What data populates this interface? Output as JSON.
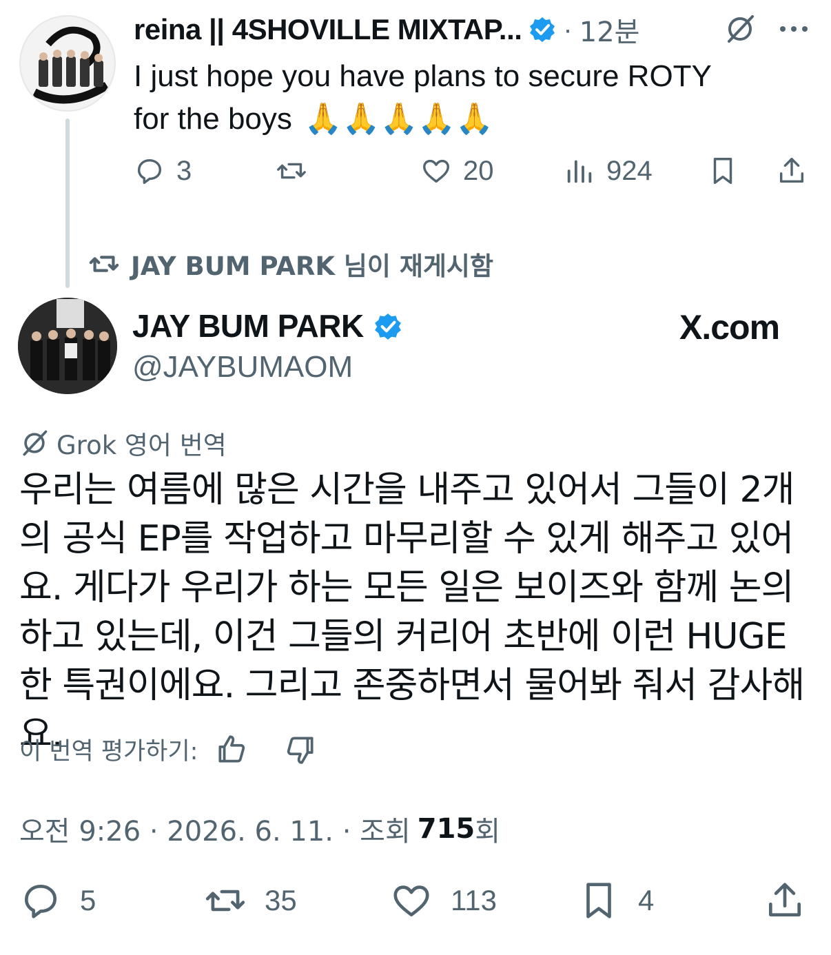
{
  "reply_tweet": {
    "author_name": "reina || 4SHOVILLE MIXTAP...",
    "time": "12분",
    "text_line1": "I just hope you have plans to secure ROTY",
    "text_line2": "for the boys",
    "emoji": "🙏🙏🙏🙏🙏",
    "reply_count": "3",
    "like_count": "20",
    "view_count": "924"
  },
  "repost_label": "JAY BUM PARK 님이 재게시함",
  "main_tweet": {
    "author_name": "JAY BUM PARK",
    "handle": "@JAYBUMAOM",
    "brand": "X.com",
    "translate_label": "Grok 영어 번역",
    "body": "우리는 여름에 많은 시간을 내주고 있어서 그들이 2개의 공식 EP를 작업하고 마무리할 수 있게 해주고 있어요. 게다가 우리가 하는 모든 일은 보이즈와 함께 논의하고 있는데, 이건 그들의 커리어 초반에 이런 HUGE한 특권이에요. 그리고 존중하면서 물어봐 줘서 감사해요.",
    "rate_label": "이 번역 평가하기:",
    "timestamp": "오전 9:26 · 2026. 6. 11. · 조회 ",
    "views": "715",
    "views_suffix": "회",
    "reply_count": "5",
    "repost_count": "35",
    "like_count": "113",
    "bookmark_count": "4"
  },
  "colors": {
    "accent": "#1d9bf0",
    "grey": "#536471",
    "line": "#cfd9de"
  }
}
